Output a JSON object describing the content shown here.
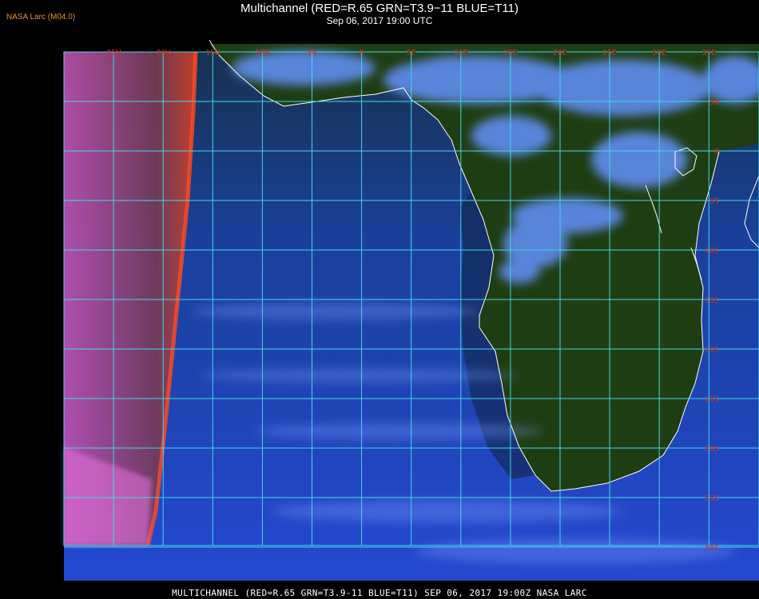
{
  "header": {
    "brand": "NASA Larc (M04.0)",
    "title": "Multichannel (RED=R.65 GRN=T3.9−11 BLUE=T11)",
    "subtitle": "Sep 06, 2017 19:00 UTC"
  },
  "footer": {
    "text": "MULTICHANNEL (RED=R.65 GRN=T3.9-11 BLUE=T11) SEP 06, 2017 19:00Z   NASA LARC"
  },
  "map": {
    "lon_labels": [
      "25W",
      "20W",
      "15W",
      "10W",
      "5W",
      "0",
      "5E",
      "10E",
      "15E",
      "20E",
      "25E",
      "30E",
      "35E"
    ],
    "lat_labels": [
      "5N",
      "0",
      "5S",
      "10S",
      "15S",
      "20S",
      "25S",
      "30S",
      "35S",
      "40S"
    ],
    "lon_range": [
      -30,
      35
    ],
    "lat_range": [
      -40,
      10
    ],
    "grid_color": "#40d8e8",
    "label_color": "#c83228",
    "coast_color": "#ffffff",
    "ocean_color": "#1a3fa0",
    "land_color": "#1f3d12",
    "cloud_color": "#5f8cf0"
  }
}
